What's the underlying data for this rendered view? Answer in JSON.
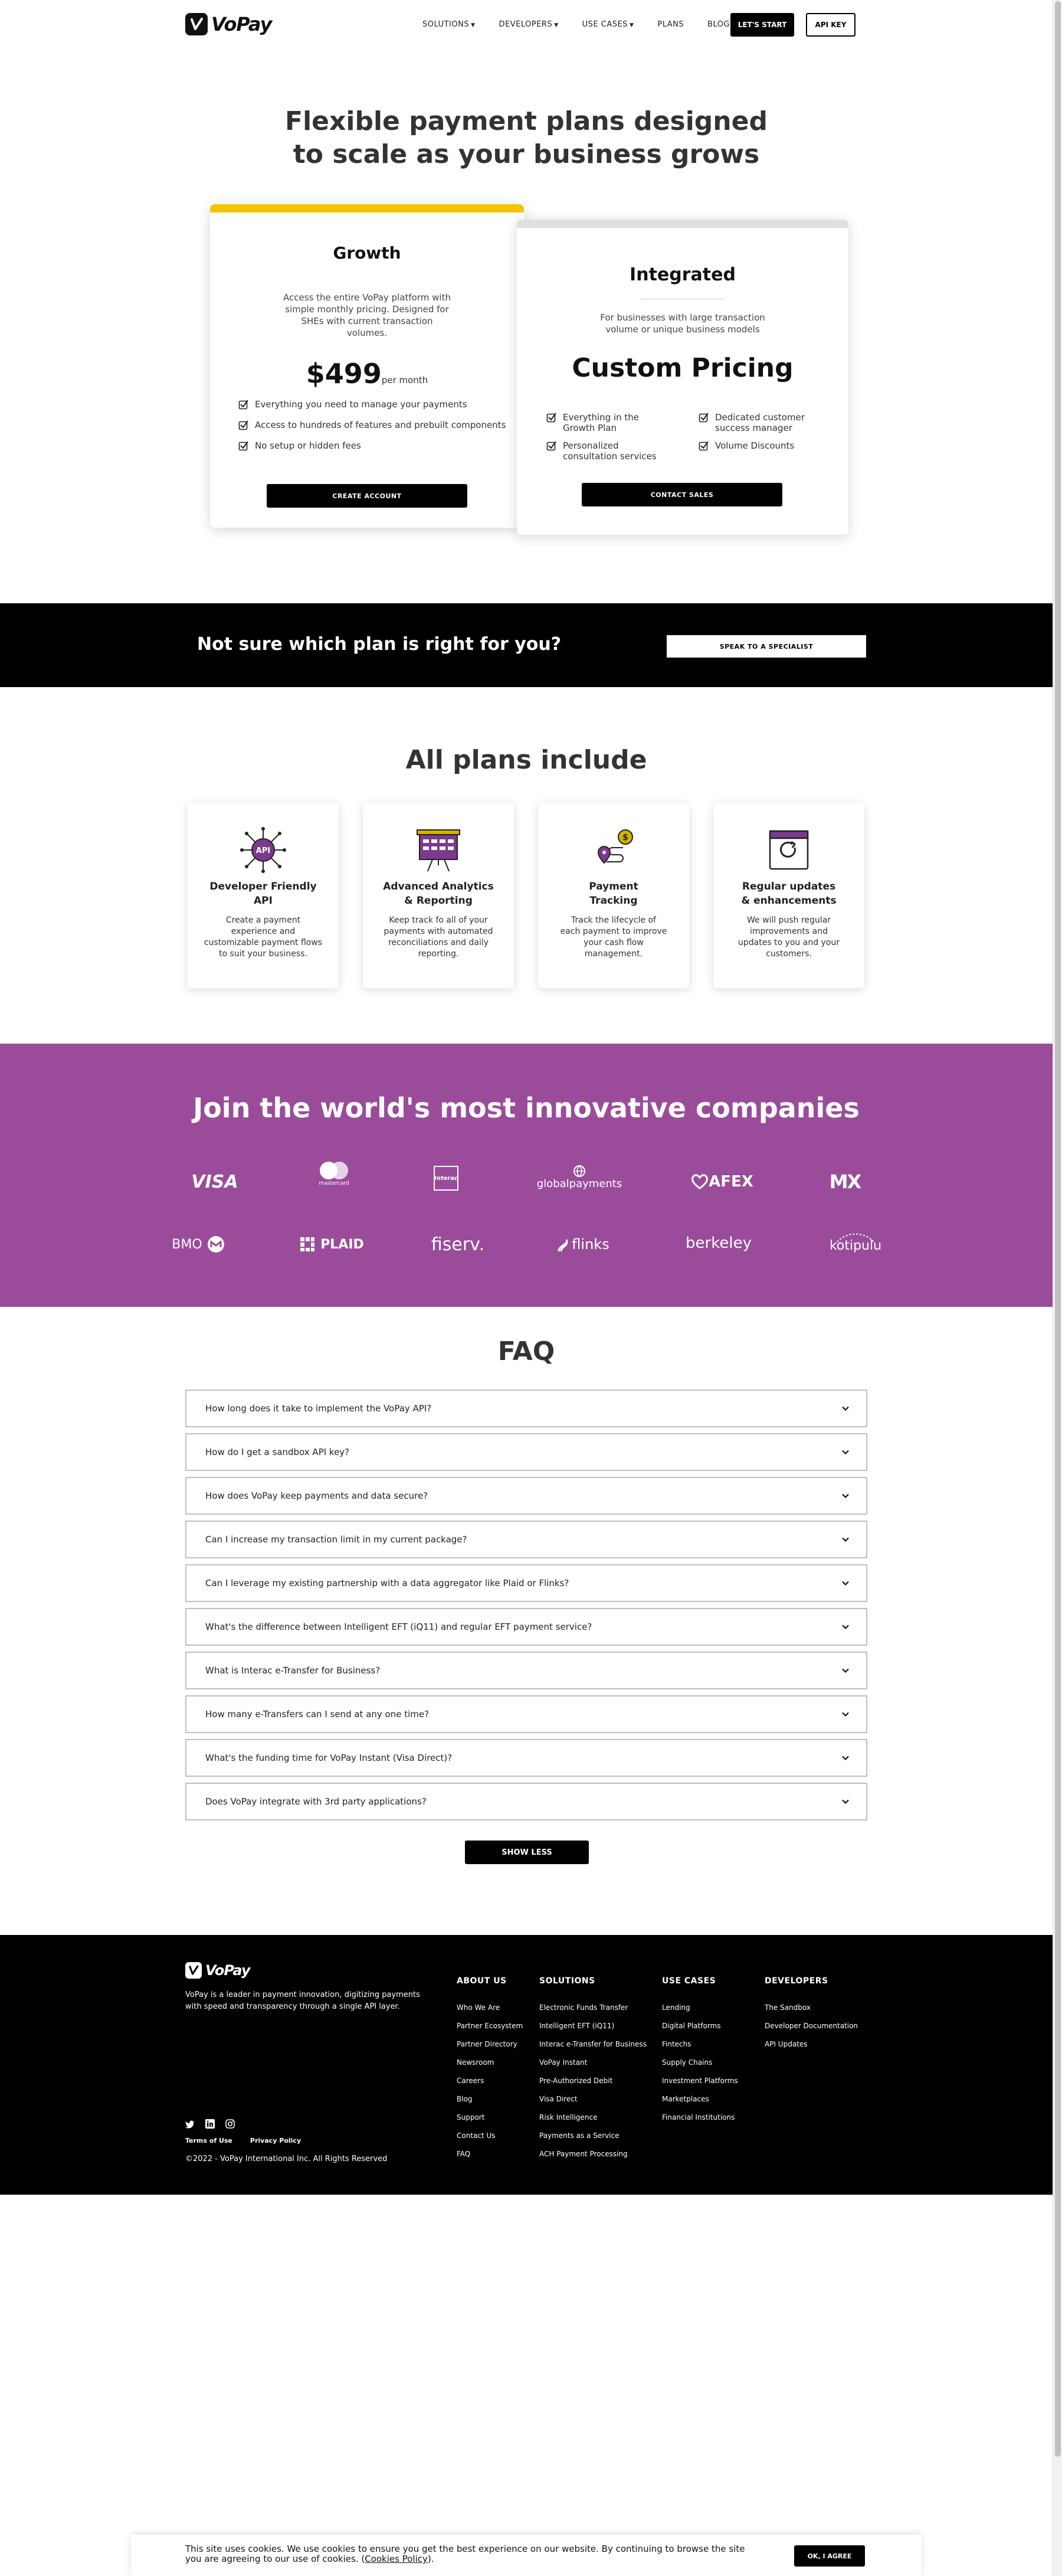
{
  "brand": {
    "name": "VoPay"
  },
  "nav": {
    "items": [
      {
        "label": "SOLUTIONS",
        "dropdown": true
      },
      {
        "label": "DEVELOPERS",
        "dropdown": true
      },
      {
        "label": "USE CASES",
        "dropdown": true
      },
      {
        "label": "PLANS",
        "dropdown": false
      },
      {
        "label": "BLOG",
        "dropdown": false
      }
    ],
    "lets_start": "LET'S START",
    "api_key": "API KEY"
  },
  "hero": {
    "line1": "Flexible payment plans designed",
    "line2": "to scale as your business grows"
  },
  "plans": {
    "growth": {
      "name": "Growth",
      "accent": "#f5c400",
      "desc1": "Access the entire VoPay platform with",
      "desc2": "simple monthly pricing. Designed for",
      "desc3": "SHEs with current transaction",
      "desc4": "volumes.",
      "price": "$499",
      "period": "per month",
      "features": [
        "Everything you need to manage your payments",
        "Access to hundreds of features and prebuilt components",
        "No setup or hidden fees"
      ],
      "cta": "CREATE ACCOUNT"
    },
    "integrated": {
      "name": "Integrated",
      "accent": "#e0e0e0",
      "desc1": "For businesses with large transaction",
      "desc2": "volume or unique business models",
      "price": "Custom Pricing",
      "features_left": [
        [
          "Everything in the",
          "Growth Plan"
        ],
        [
          "Personalized",
          "consultation services"
        ]
      ],
      "features_right": [
        [
          "Dedicated customer",
          "success manager"
        ],
        [
          "Volume Discounts"
        ]
      ],
      "cta": "CONTACT SALES"
    }
  },
  "cta_band": {
    "question": "Not sure which plan is right for you?",
    "button": "SPEAK TO A SPECIALIST"
  },
  "features": {
    "title": "All plans include",
    "items": [
      {
        "icon": "api-icon",
        "title1": "Developer Friendly",
        "title2": "API",
        "desc": [
          "Create a payment",
          "experience and",
          "customizable payment flows",
          "to suit your business."
        ]
      },
      {
        "icon": "analytics-icon",
        "title1": "Advanced Analytics",
        "title2": "& Reporting",
        "desc": [
          "Keep track fo all of your",
          "payments with automated",
          "reconciliations and daily",
          "reporting."
        ]
      },
      {
        "icon": "tracking-icon",
        "title1": "Payment",
        "title2": "Tracking",
        "desc": [
          "Track the lifecycle of",
          "each payment to improve",
          "your cash flow",
          "management."
        ]
      },
      {
        "icon": "updates-icon",
        "title1": "Regular updates",
        "title2": "& enhancements",
        "desc": [
          "We will push regular",
          "improvements and",
          "updates to you and your",
          "customers."
        ]
      }
    ]
  },
  "partners": {
    "title": "Join the world's most innovative companies",
    "row1": [
      "VISA",
      "mastercard",
      "Interac",
      "globalpayments",
      "AFEX",
      "MX"
    ],
    "row2": [
      "BMO",
      "PLAID",
      "fiserv.",
      "flinks",
      "berkeley",
      "kotipulu"
    ]
  },
  "faq": {
    "title": "FAQ",
    "items": [
      "How long does it take to implement the VoPay API?",
      "How do I get a sandbox API key?",
      "How does VoPay keep payments and data secure?",
      "Can I increase my transaction limit in my current package?",
      "Can I leverage my existing partnership with a data aggregator like Plaid or Flinks?",
      "What's the difference between Intelligent EFT (iQ11) and regular EFT payment service?",
      "What is Interac e-Transfer for Business?",
      "How many e-Transfers can I send at any one time?",
      "What's the funding time for VoPay Instant (Visa Direct)?",
      "Does VoPay integrate with 3rd party applications?"
    ],
    "show_less": "SHOW LESS"
  },
  "footer": {
    "tagline1": "VoPay is a leader in payment innovation, digitizing payments",
    "tagline2": "with speed and transparency through a single API layer.",
    "terms": "Terms of Use",
    "privacy": "Privacy Policy",
    "copyright": "©2022 - VoPay International Inc. All Rights Reserved",
    "columns": [
      {
        "heading": "ABOUT US",
        "links": [
          "Who We Are",
          "Partner Ecosystem",
          "Partner Directory",
          "Newsroom",
          "Careers",
          "Blog",
          "Support",
          "Contact Us",
          "FAQ"
        ]
      },
      {
        "heading": "SOLUTIONS",
        "links": [
          "Electronic Funds Transfer",
          "Intelligent EFT (iQ11)",
          "Interac e-Transfer for Business",
          "VoPay Instant",
          "Pre-Authorized Debit",
          "Visa Direct",
          "Risk Intelligence",
          "Payments as a Service",
          "ACH Payment Processing"
        ]
      },
      {
        "heading": "USE CASES",
        "links": [
          "Lending",
          "Digital Platforms",
          "Fintechs",
          "Supply Chains",
          "Investment Platforms",
          "Marketplaces",
          "Financial Institutions"
        ]
      },
      {
        "heading": "DEVELOPERS",
        "links": [
          "The Sandbox",
          "Developer Documentation",
          "API Updates"
        ]
      }
    ]
  },
  "cookie": {
    "text": "This site uses cookies. We use cookies to ensure you get the best experience on our website. By continuing to browse the site you are agreeing to our use of cookies. (",
    "link": "Cookies Policy",
    "tail": ").",
    "button": "OK, I AGREE"
  }
}
